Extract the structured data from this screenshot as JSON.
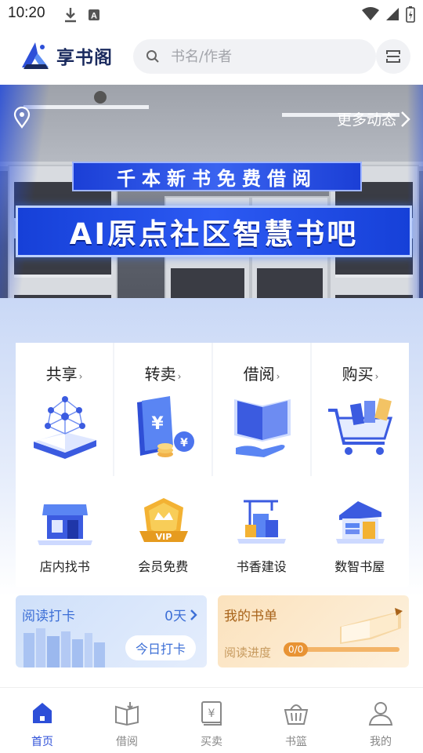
{
  "status_bar": {
    "time": "10:20"
  },
  "header": {
    "logo_text": "享书阁",
    "search_placeholder": "书名/作者"
  },
  "banner": {
    "more_label": "更多动态",
    "subtitle": "千本新书免费借阅",
    "headline": "AI原点社区智慧书吧",
    "slide_count": 5,
    "active_slide": 1
  },
  "services": [
    {
      "label": "共享",
      "arrow": "›"
    },
    {
      "label": "转卖",
      "arrow": "›"
    },
    {
      "label": "借阅",
      "arrow": "›"
    },
    {
      "label": "购买",
      "arrow": "›"
    }
  ],
  "quick_links": [
    {
      "label": "店内找书"
    },
    {
      "label": "会员免费"
    },
    {
      "label": "书香建设"
    },
    {
      "label": "数智书屋"
    }
  ],
  "reading_checkin": {
    "title": "阅读打卡",
    "days": "0天",
    "button": "今日打卡"
  },
  "my_books": {
    "title": "我的书单",
    "progress_label": "阅读进度",
    "progress_value": "0/0"
  },
  "tabs": [
    {
      "label": "首页",
      "icon": "home-icon",
      "active": true
    },
    {
      "label": "借阅",
      "icon": "borrow-book-icon",
      "active": false
    },
    {
      "label": "买卖",
      "icon": "trade-yuan-icon",
      "active": false
    },
    {
      "label": "书篮",
      "icon": "basket-icon",
      "active": false
    },
    {
      "label": "我的",
      "icon": "user-icon",
      "active": false
    }
  ],
  "colors": {
    "brand": "#2d4fd8",
    "tab_inactive": "#888888",
    "checkin_text": "#3d6fd6",
    "booklist_text": "#a8631a"
  }
}
